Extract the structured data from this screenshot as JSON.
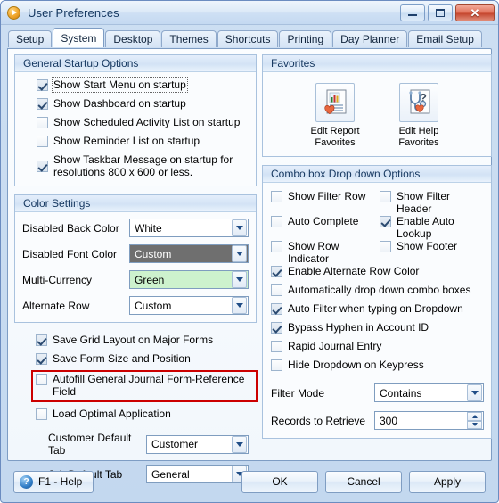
{
  "window": {
    "title": "User Preferences",
    "app_icon": "play-circle-icon",
    "controls": {
      "minimize": "Minimize",
      "maximize": "Maximize",
      "close": "Close"
    }
  },
  "tabs": [
    {
      "label": "Setup",
      "active": false
    },
    {
      "label": "System",
      "active": true
    },
    {
      "label": "Desktop",
      "active": false
    },
    {
      "label": "Themes",
      "active": false
    },
    {
      "label": "Shortcuts",
      "active": false
    },
    {
      "label": "Printing",
      "active": false
    },
    {
      "label": "Day Planner",
      "active": false
    },
    {
      "label": "Email Setup",
      "active": false
    }
  ],
  "general_startup": {
    "title": "General Startup Options",
    "items": [
      {
        "label": "Show Start Menu on startup",
        "checked": true,
        "focused": true
      },
      {
        "label": "Show Dashboard on startup",
        "checked": true,
        "focused": false
      },
      {
        "label": "Show Scheduled Activity List on startup",
        "checked": false,
        "focused": false
      },
      {
        "label": "Show Reminder List on startup",
        "checked": false,
        "focused": false
      },
      {
        "label": "Show Taskbar Message on startup for resolutions 800 x 600 or less.",
        "checked": true,
        "focused": false
      }
    ]
  },
  "color_settings": {
    "title": "Color Settings",
    "fields": [
      {
        "label": "Disabled Back Color",
        "value": "White",
        "style": "plain"
      },
      {
        "label": "Disabled Font Color",
        "value": "Custom",
        "style": "dark"
      },
      {
        "label": "Multi-Currency",
        "value": "Green",
        "style": "green"
      },
      {
        "label": "Alternate Row",
        "value": "Custom",
        "style": "plain"
      }
    ]
  },
  "form_options": {
    "checkboxes": [
      {
        "label": "Save Grid Layout on Major Forms",
        "checked": true
      },
      {
        "label": "Save Form Size and Position",
        "checked": true
      },
      {
        "label": "Autofill General Journal Form-Reference Field",
        "checked": false,
        "highlighted": true
      },
      {
        "label": "Load Optimal Application",
        "checked": false
      }
    ],
    "fields": [
      {
        "label": "Customer Default Tab",
        "value": "Customer"
      },
      {
        "label": "Job Default Tab",
        "value": "General"
      }
    ]
  },
  "favorites": {
    "title": "Favorites",
    "items": [
      {
        "caption": "Edit Report Favorites",
        "icon": "report-chart-heart-icon"
      },
      {
        "caption": "Edit Help Favorites",
        "icon": "help-stethoscope-heart-icon"
      }
    ]
  },
  "combo_options": {
    "title": "Combo box Drop down Options",
    "grid_rows": [
      [
        {
          "label": "Show Filter Row",
          "checked": false
        },
        {
          "label": "Show Filter Header",
          "checked": false
        }
      ],
      [
        {
          "label": "Auto Complete",
          "checked": false
        },
        {
          "label": "Enable Auto Lookup",
          "checked": true
        }
      ],
      [
        {
          "label": "Show Row Indicator",
          "checked": false
        },
        {
          "label": "Show Footer",
          "checked": false
        }
      ]
    ],
    "full_rows": [
      {
        "label": "Enable Alternate Row Color",
        "checked": true
      },
      {
        "label": "Automatically drop down combo boxes",
        "checked": false
      },
      {
        "label": "Auto Filter when typing on Dropdown",
        "checked": true
      },
      {
        "label": "Bypass Hyphen in Account ID",
        "checked": true
      },
      {
        "label": "Rapid Journal Entry",
        "checked": false
      },
      {
        "label": "Hide Dropdown on Keypress",
        "checked": false
      }
    ],
    "fields": [
      {
        "label": "Filter Mode",
        "value": "Contains",
        "type": "combo"
      },
      {
        "label": "Records to Retrieve",
        "value": "300",
        "type": "spinner"
      }
    ]
  },
  "footer": {
    "help_label": "F1 - Help",
    "help_icon": "question-circle-icon",
    "ok_label": "OK",
    "cancel_label": "Cancel",
    "apply_label": "Apply"
  },
  "annotation": {
    "highlight_color": "#cc0000"
  }
}
